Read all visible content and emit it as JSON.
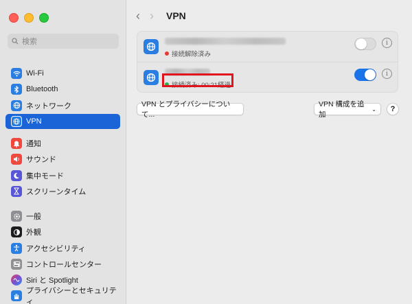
{
  "sidebar": {
    "search_placeholder": "検索",
    "group_network": [
      {
        "label": "Wi-Fi",
        "icon": "wifi-icon",
        "color": "#2a7de1"
      },
      {
        "label": "Bluetooth",
        "icon": "bluetooth-icon",
        "color": "#2a7de1"
      },
      {
        "label": "ネットワーク",
        "icon": "network-globe-icon",
        "color": "#2a7de1"
      },
      {
        "label": "VPN",
        "icon": "vpn-globe-icon",
        "color": "#2a7de1",
        "active": true
      }
    ],
    "group_notify": [
      {
        "label": "通知",
        "icon": "bell-icon",
        "color": "#f0473e"
      },
      {
        "label": "サウンド",
        "icon": "speaker-icon",
        "color": "#f0473e"
      },
      {
        "label": "集中モード",
        "icon": "moon-icon",
        "color": "#5856d6"
      },
      {
        "label": "スクリーンタイム",
        "icon": "hourglass-icon",
        "color": "#5856d6"
      }
    ],
    "group_general": [
      {
        "label": "一般",
        "icon": "gear-icon",
        "color": "#8e8e93"
      },
      {
        "label": "外観",
        "icon": "appearance-icon",
        "color": "#1c1c1e"
      },
      {
        "label": "アクセシビリティ",
        "icon": "accessibility-icon",
        "color": "#2a7de1"
      },
      {
        "label": "コントロールセンター",
        "icon": "control-center-icon",
        "color": "#8e8e93"
      },
      {
        "label": "Siri と Spotlight",
        "icon": "siri-icon",
        "color": "#7b4fd1"
      },
      {
        "label": "プライバシーとセキュリティ",
        "icon": "hand-icon",
        "color": "#2a7de1"
      }
    ]
  },
  "header": {
    "back": "‹",
    "forward": "›",
    "title": "VPN"
  },
  "vpn_list": [
    {
      "status": "接続解除済み",
      "status_color": "#e53935",
      "enabled": false
    },
    {
      "status": "接続済み: 00:21経過",
      "status_color": "#2bb14a",
      "enabled": true
    }
  ],
  "actions": {
    "privacy_button": "VPN とプライバシーについて...",
    "add_button": "VPN 構成を追加",
    "add_caret": "⌄",
    "help": "?",
    "info": "i"
  },
  "accent_color": "#1a64d8",
  "highlight_color": "#e0141e"
}
